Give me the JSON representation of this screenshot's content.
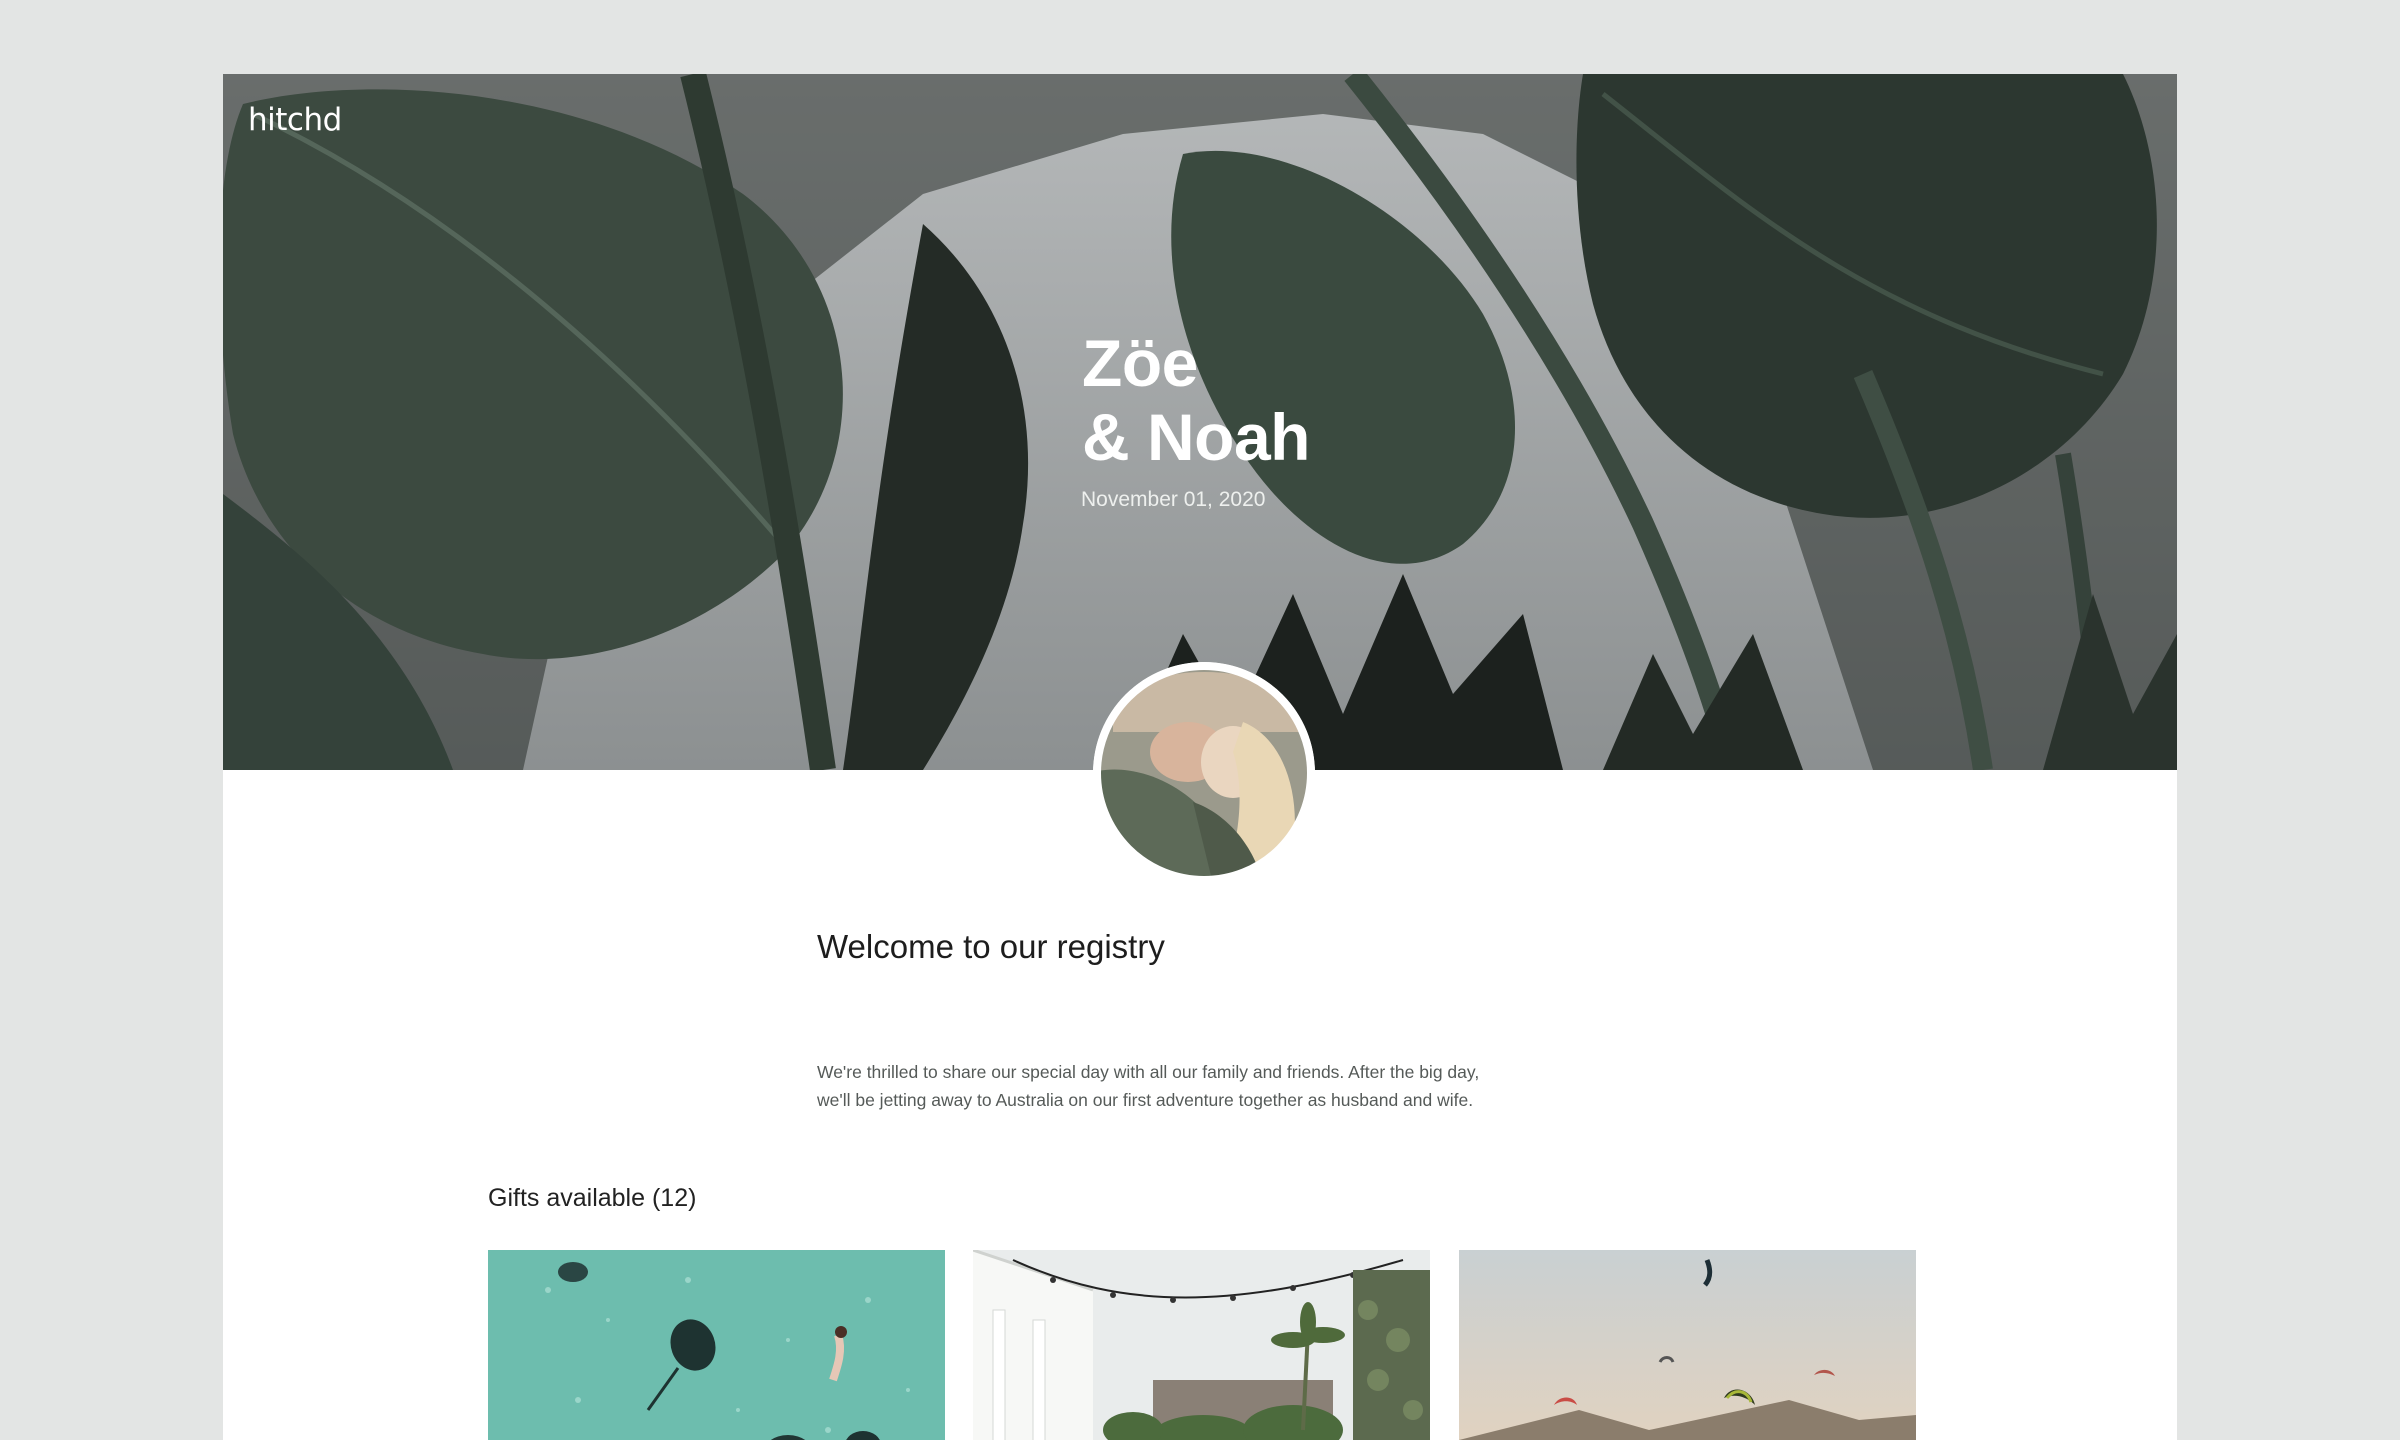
{
  "brand": {
    "logo_text": "hitchd",
    "accent": "#2f3d33"
  },
  "hero": {
    "couple_line_1": "Zöe",
    "couple_line_2": "& Noah",
    "date": "November 01, 2020"
  },
  "welcome": {
    "title": "Welcome to our registry",
    "text_line_1": "We're thrilled to share our special day with all our family and friends. After the big day,",
    "text_line_2": "we'll be jetting away to Australia on our first adventure together as husband and wife."
  },
  "gifts": {
    "heading": "Gifts available (12)",
    "items": [
      {
        "image": "aerial-ocean-stingrays-photo"
      },
      {
        "image": "courtyard-festoon-lights-photo"
      },
      {
        "image": "kitesurf-mountains-photo"
      }
    ]
  }
}
